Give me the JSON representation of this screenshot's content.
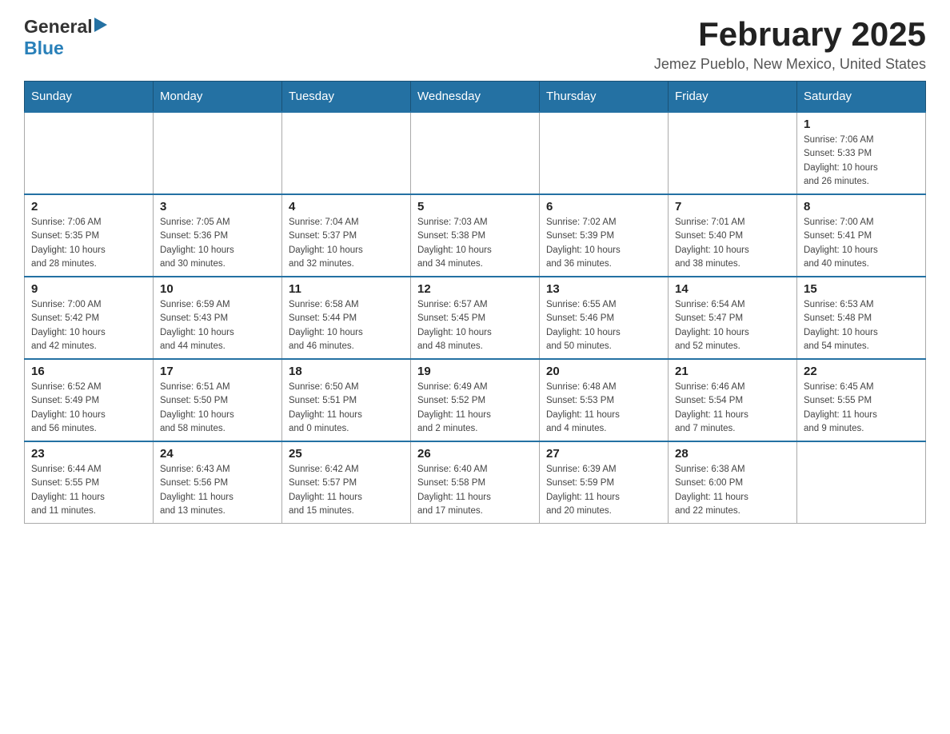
{
  "header": {
    "logo_general": "General",
    "logo_blue": "Blue",
    "month_title": "February 2025",
    "location": "Jemez Pueblo, New Mexico, United States"
  },
  "days_of_week": [
    "Sunday",
    "Monday",
    "Tuesday",
    "Wednesday",
    "Thursday",
    "Friday",
    "Saturday"
  ],
  "weeks": [
    {
      "days": [
        {
          "number": "",
          "info": ""
        },
        {
          "number": "",
          "info": ""
        },
        {
          "number": "",
          "info": ""
        },
        {
          "number": "",
          "info": ""
        },
        {
          "number": "",
          "info": ""
        },
        {
          "number": "",
          "info": ""
        },
        {
          "number": "1",
          "info": "Sunrise: 7:06 AM\nSunset: 5:33 PM\nDaylight: 10 hours\nand 26 minutes."
        }
      ]
    },
    {
      "days": [
        {
          "number": "2",
          "info": "Sunrise: 7:06 AM\nSunset: 5:35 PM\nDaylight: 10 hours\nand 28 minutes."
        },
        {
          "number": "3",
          "info": "Sunrise: 7:05 AM\nSunset: 5:36 PM\nDaylight: 10 hours\nand 30 minutes."
        },
        {
          "number": "4",
          "info": "Sunrise: 7:04 AM\nSunset: 5:37 PM\nDaylight: 10 hours\nand 32 minutes."
        },
        {
          "number": "5",
          "info": "Sunrise: 7:03 AM\nSunset: 5:38 PM\nDaylight: 10 hours\nand 34 minutes."
        },
        {
          "number": "6",
          "info": "Sunrise: 7:02 AM\nSunset: 5:39 PM\nDaylight: 10 hours\nand 36 minutes."
        },
        {
          "number": "7",
          "info": "Sunrise: 7:01 AM\nSunset: 5:40 PM\nDaylight: 10 hours\nand 38 minutes."
        },
        {
          "number": "8",
          "info": "Sunrise: 7:00 AM\nSunset: 5:41 PM\nDaylight: 10 hours\nand 40 minutes."
        }
      ]
    },
    {
      "days": [
        {
          "number": "9",
          "info": "Sunrise: 7:00 AM\nSunset: 5:42 PM\nDaylight: 10 hours\nand 42 minutes."
        },
        {
          "number": "10",
          "info": "Sunrise: 6:59 AM\nSunset: 5:43 PM\nDaylight: 10 hours\nand 44 minutes."
        },
        {
          "number": "11",
          "info": "Sunrise: 6:58 AM\nSunset: 5:44 PM\nDaylight: 10 hours\nand 46 minutes."
        },
        {
          "number": "12",
          "info": "Sunrise: 6:57 AM\nSunset: 5:45 PM\nDaylight: 10 hours\nand 48 minutes."
        },
        {
          "number": "13",
          "info": "Sunrise: 6:55 AM\nSunset: 5:46 PM\nDaylight: 10 hours\nand 50 minutes."
        },
        {
          "number": "14",
          "info": "Sunrise: 6:54 AM\nSunset: 5:47 PM\nDaylight: 10 hours\nand 52 minutes."
        },
        {
          "number": "15",
          "info": "Sunrise: 6:53 AM\nSunset: 5:48 PM\nDaylight: 10 hours\nand 54 minutes."
        }
      ]
    },
    {
      "days": [
        {
          "number": "16",
          "info": "Sunrise: 6:52 AM\nSunset: 5:49 PM\nDaylight: 10 hours\nand 56 minutes."
        },
        {
          "number": "17",
          "info": "Sunrise: 6:51 AM\nSunset: 5:50 PM\nDaylight: 10 hours\nand 58 minutes."
        },
        {
          "number": "18",
          "info": "Sunrise: 6:50 AM\nSunset: 5:51 PM\nDaylight: 11 hours\nand 0 minutes."
        },
        {
          "number": "19",
          "info": "Sunrise: 6:49 AM\nSunset: 5:52 PM\nDaylight: 11 hours\nand 2 minutes."
        },
        {
          "number": "20",
          "info": "Sunrise: 6:48 AM\nSunset: 5:53 PM\nDaylight: 11 hours\nand 4 minutes."
        },
        {
          "number": "21",
          "info": "Sunrise: 6:46 AM\nSunset: 5:54 PM\nDaylight: 11 hours\nand 7 minutes."
        },
        {
          "number": "22",
          "info": "Sunrise: 6:45 AM\nSunset: 5:55 PM\nDaylight: 11 hours\nand 9 minutes."
        }
      ]
    },
    {
      "days": [
        {
          "number": "23",
          "info": "Sunrise: 6:44 AM\nSunset: 5:55 PM\nDaylight: 11 hours\nand 11 minutes."
        },
        {
          "number": "24",
          "info": "Sunrise: 6:43 AM\nSunset: 5:56 PM\nDaylight: 11 hours\nand 13 minutes."
        },
        {
          "number": "25",
          "info": "Sunrise: 6:42 AM\nSunset: 5:57 PM\nDaylight: 11 hours\nand 15 minutes."
        },
        {
          "number": "26",
          "info": "Sunrise: 6:40 AM\nSunset: 5:58 PM\nDaylight: 11 hours\nand 17 minutes."
        },
        {
          "number": "27",
          "info": "Sunrise: 6:39 AM\nSunset: 5:59 PM\nDaylight: 11 hours\nand 20 minutes."
        },
        {
          "number": "28",
          "info": "Sunrise: 6:38 AM\nSunset: 6:00 PM\nDaylight: 11 hours\nand 22 minutes."
        },
        {
          "number": "",
          "info": ""
        }
      ]
    }
  ]
}
